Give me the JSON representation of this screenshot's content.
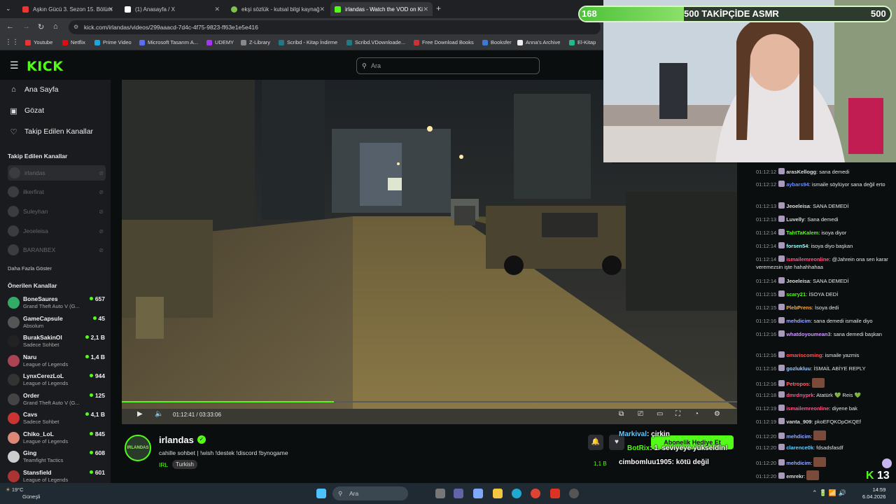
{
  "browser": {
    "tabs": [
      {
        "title": "Aşkın Gücü 3. Sezon 15. Bölüm",
        "color": "#e33"
      },
      {
        "title": "(1) Anasayfa / X",
        "color": "#fff"
      },
      {
        "title": "ekşi sözlük - kutsal bilgi kaynağ",
        "color": "#81c14b"
      },
      {
        "title": "irlandas - Watch the VOD on Ki",
        "color": "#53fc18"
      }
    ],
    "url": "kick.com/irlandas/videos/299aaacd-7d4c-4f75-9823-ff63e1e5e416",
    "bookmarks": [
      {
        "label": "Youtube",
        "color": "#e33"
      },
      {
        "label": "Netflix",
        "color": "#e50914"
      },
      {
        "label": "Prime Video",
        "color": "#1aa6df"
      },
      {
        "label": "Microsoft Tasarım A...",
        "color": "#5b6cf5"
      },
      {
        "label": "UDEMY",
        "color": "#a435f0"
      },
      {
        "label": "Z-Library",
        "color": "#888"
      },
      {
        "label": "Scribd - Kitap İndirme",
        "color": "#1e7b85"
      },
      {
        "label": "Scribd.VDownloade...",
        "color": "#1e7b85"
      },
      {
        "label": "Free Download Books",
        "color": "#c33"
      },
      {
        "label": "Booksfer",
        "color": "#3a7bd5"
      },
      {
        "label": "Anna's Archive",
        "color": "#eee"
      },
      {
        "label": "El-Kitap",
        "color": "#2b8"
      }
    ]
  },
  "kick": {
    "logo": "KICK",
    "search_placeholder": "Ara"
  },
  "sidebar": {
    "nav": [
      {
        "label": "Ana Sayfa",
        "icon": "home-icon",
        "glyph": "⌂"
      },
      {
        "label": "Gözat",
        "icon": "browse-icon",
        "glyph": "▣"
      },
      {
        "label": "Takip Edilen Kanallar",
        "icon": "heart-icon",
        "glyph": "♡"
      }
    ],
    "followed_heading": "Takip Edilen Kanallar",
    "followed": [
      "irlandas",
      "ilkerfirat",
      "Suleyhan",
      "Jeoeleisa",
      "BARANBEX"
    ],
    "show_more": "Daha Fazla Göster",
    "recommended_heading": "Önerilen Kanallar",
    "recommended": [
      {
        "name": "BoneSaures",
        "category": "Grand Theft Auto V (G...",
        "viewers": "657",
        "color": "#3a6"
      },
      {
        "name": "GameCapsule",
        "category": "Absolum",
        "viewers": "45",
        "color": "#555"
      },
      {
        "name": "BurakSakinOl",
        "category": "Sadece Sohbet",
        "viewers": "2,1 B",
        "color": "#222"
      },
      {
        "name": "Naru",
        "category": "League of Legends",
        "viewers": "1,4 B",
        "color": "#a45"
      },
      {
        "name": "LynxCerezLoL",
        "category": "League of Legends",
        "viewers": "944",
        "color": "#333"
      },
      {
        "name": "Order",
        "category": "Grand Theft Auto V (G...",
        "viewers": "125",
        "color": "#444"
      },
      {
        "name": "Cavs",
        "category": "Sadece Sohbet",
        "viewers": "4,1 B",
        "color": "#c33"
      },
      {
        "name": "Chiko_LoL",
        "category": "League of Legends",
        "viewers": "845",
        "color": "#d87"
      },
      {
        "name": "Ging",
        "category": "Teamfight Tactics",
        "viewers": "608",
        "color": "#ccc"
      },
      {
        "name": "Stansfield",
        "category": "League of Legends",
        "viewers": "601",
        "color": "#a33"
      }
    ]
  },
  "player": {
    "timecode": "01:12:41 / 03:33:06",
    "progress": 0.345
  },
  "stream": {
    "channel": "irlandas",
    "avatar_text": "IRLANDAS",
    "title": "cahille sohbet | !wish !destek !discord !bynogame",
    "category": "IRL",
    "language": "Turkish",
    "viewers_prefix": "1,1 B",
    "gift_label": "Abonelik Hediye Et"
  },
  "overlay": {
    "goal_current": "168",
    "goal_text": "500 TAKİPÇİDE ASMR",
    "goal_target": "500",
    "goal_fraction": 0.336,
    "messages": [
      {
        "user": "Markival",
        "text": ": çirkin",
        "color": "#6cf"
      },
      {
        "user": "BotRix",
        "text": ": 1. seviyeye yükseldin!",
        "color": "#53fc18"
      },
      {
        "user": "cimbomluu1905",
        "text": ": kötü değil",
        "color": "#fff"
      }
    ],
    "kick_counter": "13"
  },
  "chat": {
    "messages": [
      {
        "time": "01:12:12",
        "user": "arasKellogg",
        "color": "#ddd",
        "text": ": sana demedi"
      },
      {
        "time": "01:12:12",
        "user": "aybars94",
        "color": "#6a8cff",
        "text": ": ismaile söylüyor sana değil erto"
      },
      {
        "time": "01:12:13",
        "user": "Jeoeleisa",
        "color": "#ddd",
        "text": ": SANA DEMEDİ"
      },
      {
        "time": "01:12:13",
        "user": "Luvelly",
        "color": "#ddd",
        "text": ": Sana demedi"
      },
      {
        "time": "01:12:14",
        "user": "TahtTaKalem",
        "color": "#53fc18",
        "text": ": isoya diyor"
      },
      {
        "time": "01:12:14",
        "user": "forsen54",
        "color": "#9ff",
        "text": ": isoya diyo başkan"
      },
      {
        "time": "01:12:14",
        "user": "ismailemreonline",
        "color": "#f58",
        "text": ": @Jahrein ona sen karar veremezsin işte hahahhahaa"
      },
      {
        "time": "01:12:14",
        "user": "Jeoeleisa",
        "color": "#ddd",
        "text": ": SANA DEMEDİ"
      },
      {
        "time": "01:12:15",
        "user": "scary21",
        "color": "#53fc18",
        "text": ": İSOYA DEDİ"
      },
      {
        "time": "01:12:15",
        "user": "PlebPrens",
        "color": "#fa3",
        "text": ": İsoya dedi"
      },
      {
        "time": "01:12:16",
        "user": "mehdicim",
        "color": "#9af",
        "text": ": sana demedi ismaile diyo"
      },
      {
        "time": "01:12:16",
        "user": "whatdoyoumean3",
        "color": "#c9f",
        "text": ": sana demedi başkan"
      },
      {
        "time": "01:12:16",
        "user": "omariscoming",
        "color": "#f55",
        "text": ": ismaile yazmis"
      },
      {
        "time": "01:12:16",
        "user": "gozlukluu",
        "color": "#9cf",
        "text": ": İSMAİL ABİYE REPLY"
      },
      {
        "time": "01:12:16",
        "user": "Petropos",
        "color": "#f66",
        "text": ":"
      },
      {
        "time": "01:12:18",
        "user": "dmrdnyprk",
        "color": "#f58",
        "text": ": Atatürk 💚 Reis 💚"
      },
      {
        "time": "01:12:19",
        "user": "ismailemreonline",
        "color": "#f58",
        "text": ": diyene bak"
      },
      {
        "time": "01:12:19",
        "user": "vanta_909",
        "color": "#ddd",
        "text": ": pkoEFQKOpOKQEf"
      },
      {
        "time": "01:12:20",
        "user": "mehdicim",
        "color": "#9af",
        "text": ":"
      },
      {
        "time": "01:12:20",
        "user": "clarence0k",
        "color": "#6cf",
        "text": ": fdsadsfasdf"
      },
      {
        "time": "01:12:20",
        "user": "mehdicim",
        "color": "#9af",
        "text": ":"
      },
      {
        "time": "01:12:20",
        "user": "emrekr",
        "color": "#ddd",
        "text": ":"
      }
    ]
  },
  "taskbar": {
    "weather_temp": "19°C",
    "weather_desc": "Güneşli",
    "search": "Ara",
    "time": "14:59",
    "date": "6.04.2026"
  }
}
